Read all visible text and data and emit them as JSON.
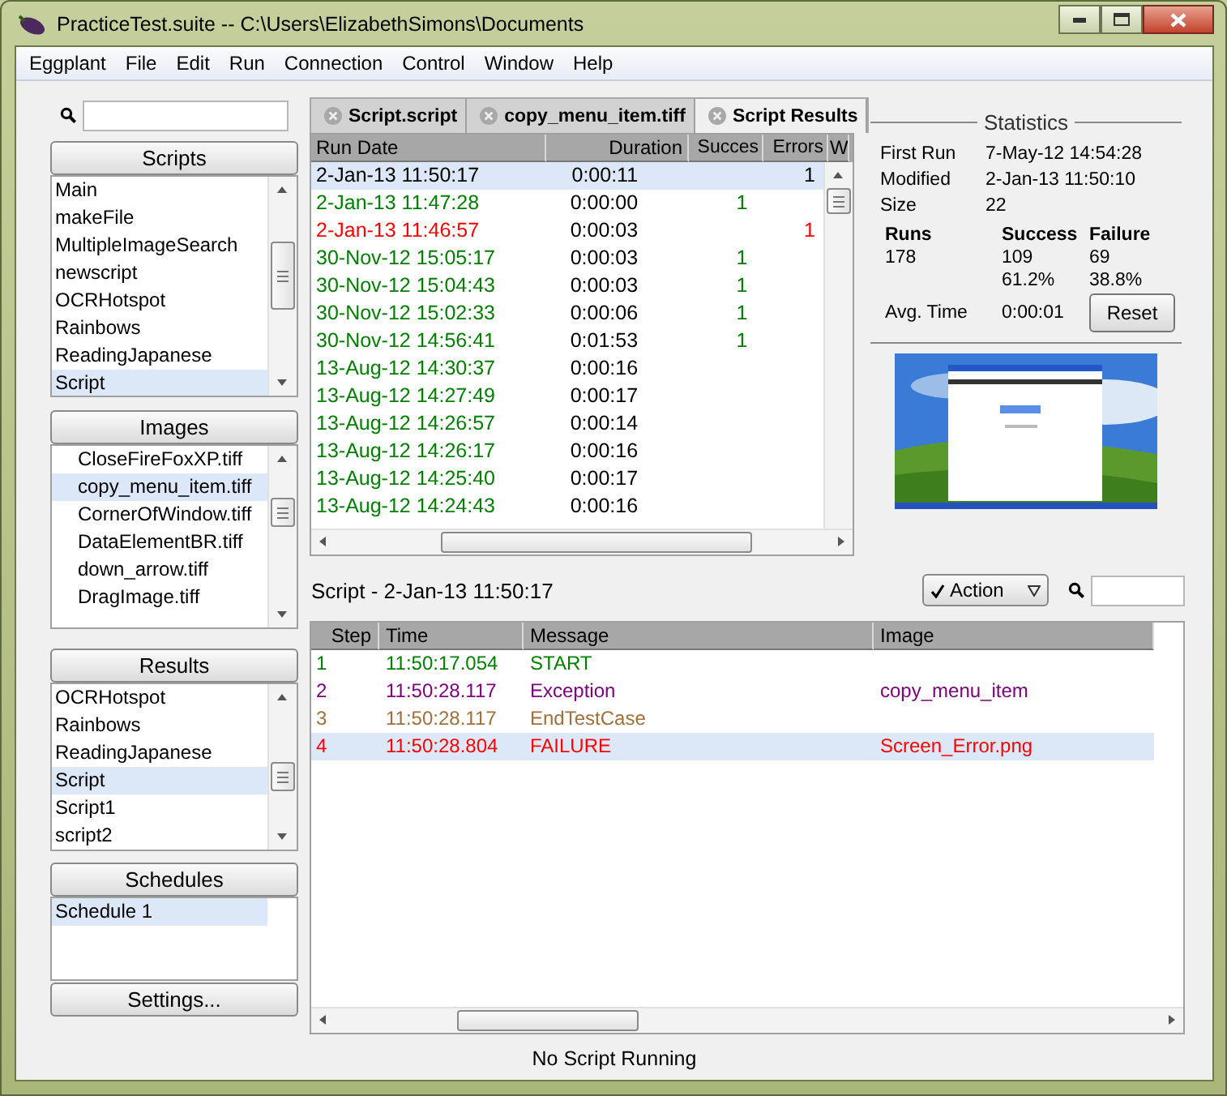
{
  "window": {
    "title": "PracticeTest.suite -- C:\\Users\\ElizabethSimons\\Documents"
  },
  "menu": [
    "Eggplant",
    "File",
    "Edit",
    "Run",
    "Connection",
    "Control",
    "Window",
    "Help"
  ],
  "sidebar": {
    "sections": [
      {
        "title": "Scripts",
        "indent": false,
        "items": [
          {
            "label": "Main",
            "selected": false
          },
          {
            "label": "makeFile",
            "selected": false
          },
          {
            "label": "MultipleImageSearch",
            "selected": false
          },
          {
            "label": "newscript",
            "selected": false
          },
          {
            "label": "OCRHotspot",
            "selected": false
          },
          {
            "label": "Rainbows",
            "selected": false
          },
          {
            "label": "ReadingJapanese",
            "selected": false
          },
          {
            "label": "Script",
            "selected": true
          }
        ]
      },
      {
        "title": "Images",
        "indent": true,
        "items": [
          {
            "label": "CloseFireFoxXP.tiff",
            "selected": false
          },
          {
            "label": "copy_menu_item.tiff",
            "selected": true
          },
          {
            "label": "CornerOfWindow.tiff",
            "selected": false
          },
          {
            "label": "DataElementBR.tiff",
            "selected": false
          },
          {
            "label": "down_arrow.tiff",
            "selected": false
          },
          {
            "label": "DragImage.tiff",
            "selected": false
          }
        ]
      },
      {
        "title": "Results",
        "indent": false,
        "items": [
          {
            "label": "OCRHotspot",
            "selected": false
          },
          {
            "label": "Rainbows",
            "selected": false
          },
          {
            "label": "ReadingJapanese",
            "selected": false
          },
          {
            "label": "Script",
            "selected": true
          },
          {
            "label": "Script1",
            "selected": false
          },
          {
            "label": "script2",
            "selected": false
          }
        ]
      },
      {
        "title": "Schedules",
        "indent": false,
        "items": [
          {
            "label": "Schedule 1",
            "selected": true
          }
        ]
      }
    ],
    "settings_button": "Settings..."
  },
  "tabs": [
    {
      "label": "Script.script",
      "selected": false
    },
    {
      "label": "copy_menu_item.tiff",
      "selected": false
    },
    {
      "label": "Script Results",
      "selected": true
    }
  ],
  "results_table": {
    "columns": [
      "Run Date",
      "Duration",
      "Succes",
      "Errors",
      "W"
    ],
    "rows": [
      {
        "run_date": "2-Jan-13 11:50:17",
        "duration": "0:00:11",
        "errors": "1",
        "color": "#000000",
        "selected": true
      },
      {
        "run_date": "2-Jan-13 11:47:28",
        "duration": "0:00:00",
        "successes": "1",
        "color": "#008000",
        "selected": false
      },
      {
        "run_date": "2-Jan-13 11:46:57",
        "duration": "0:00:03",
        "errors": "1",
        "color": "#ff0000",
        "selected": false
      },
      {
        "run_date": "30-Nov-12 15:05:17",
        "duration": "0:00:03",
        "successes": "1",
        "color": "#008000",
        "selected": false
      },
      {
        "run_date": "30-Nov-12 15:04:43",
        "duration": "0:00:03",
        "successes": "1",
        "color": "#008000",
        "selected": false
      },
      {
        "run_date": "30-Nov-12 15:02:33",
        "duration": "0:00:06",
        "successes": "1",
        "color": "#008000",
        "selected": false
      },
      {
        "run_date": "30-Nov-12 14:56:41",
        "duration": "0:01:53",
        "successes": "1",
        "color": "#008000",
        "selected": false
      },
      {
        "run_date": "13-Aug-12 14:30:37",
        "duration": "0:00:16",
        "color": "#008000",
        "selected": false
      },
      {
        "run_date": "13-Aug-12 14:27:49",
        "duration": "0:00:17",
        "color": "#008000",
        "selected": false
      },
      {
        "run_date": "13-Aug-12 14:26:57",
        "duration": "0:00:14",
        "color": "#008000",
        "selected": false
      },
      {
        "run_date": "13-Aug-12 14:26:17",
        "duration": "0:00:16",
        "color": "#008000",
        "selected": false
      },
      {
        "run_date": "13-Aug-12 14:25:40",
        "duration": "0:00:17",
        "color": "#008000",
        "selected": false
      },
      {
        "run_date": "13-Aug-12 14:24:43",
        "duration": "0:00:16",
        "color": "#008000",
        "selected": false
      }
    ]
  },
  "statistics": {
    "title": "Statistics",
    "fields": [
      {
        "label": "First Run",
        "value": "7-May-12 14:54:28"
      },
      {
        "label": "Modified",
        "value": "2-Jan-13 11:50:10"
      },
      {
        "label": "Size",
        "value": "22"
      }
    ],
    "columns": [
      "Runs",
      "Success",
      "Failure"
    ],
    "counts": [
      "178",
      "109",
      "69"
    ],
    "percents": [
      "61.2%",
      "38.8%"
    ],
    "avg_time_label": "Avg. Time",
    "avg_time": "0:00:01",
    "reset_button": "Reset"
  },
  "log": {
    "title": "Script - 2-Jan-13 11:50:17",
    "action_filter": "Action",
    "columns": [
      "Step",
      "Time",
      "Message",
      "Image"
    ],
    "rows": [
      {
        "step": "1",
        "time": "11:50:17.054",
        "message": "START",
        "color": "#008000",
        "selected": false
      },
      {
        "step": "2",
        "time": "11:50:28.117",
        "message": "Exception",
        "image": "copy_menu_item",
        "color": "#800080",
        "selected": false
      },
      {
        "step": "3",
        "time": "11:50:28.117",
        "message": "EndTestCase",
        "color": "#a0703c",
        "selected": false
      },
      {
        "step": "4",
        "time": "11:50:28.804",
        "message": "FAILURE",
        "image": "Screen_Error.png",
        "color": "#ff0000",
        "selected": true
      }
    ]
  },
  "status_bar": "No Script Running"
}
